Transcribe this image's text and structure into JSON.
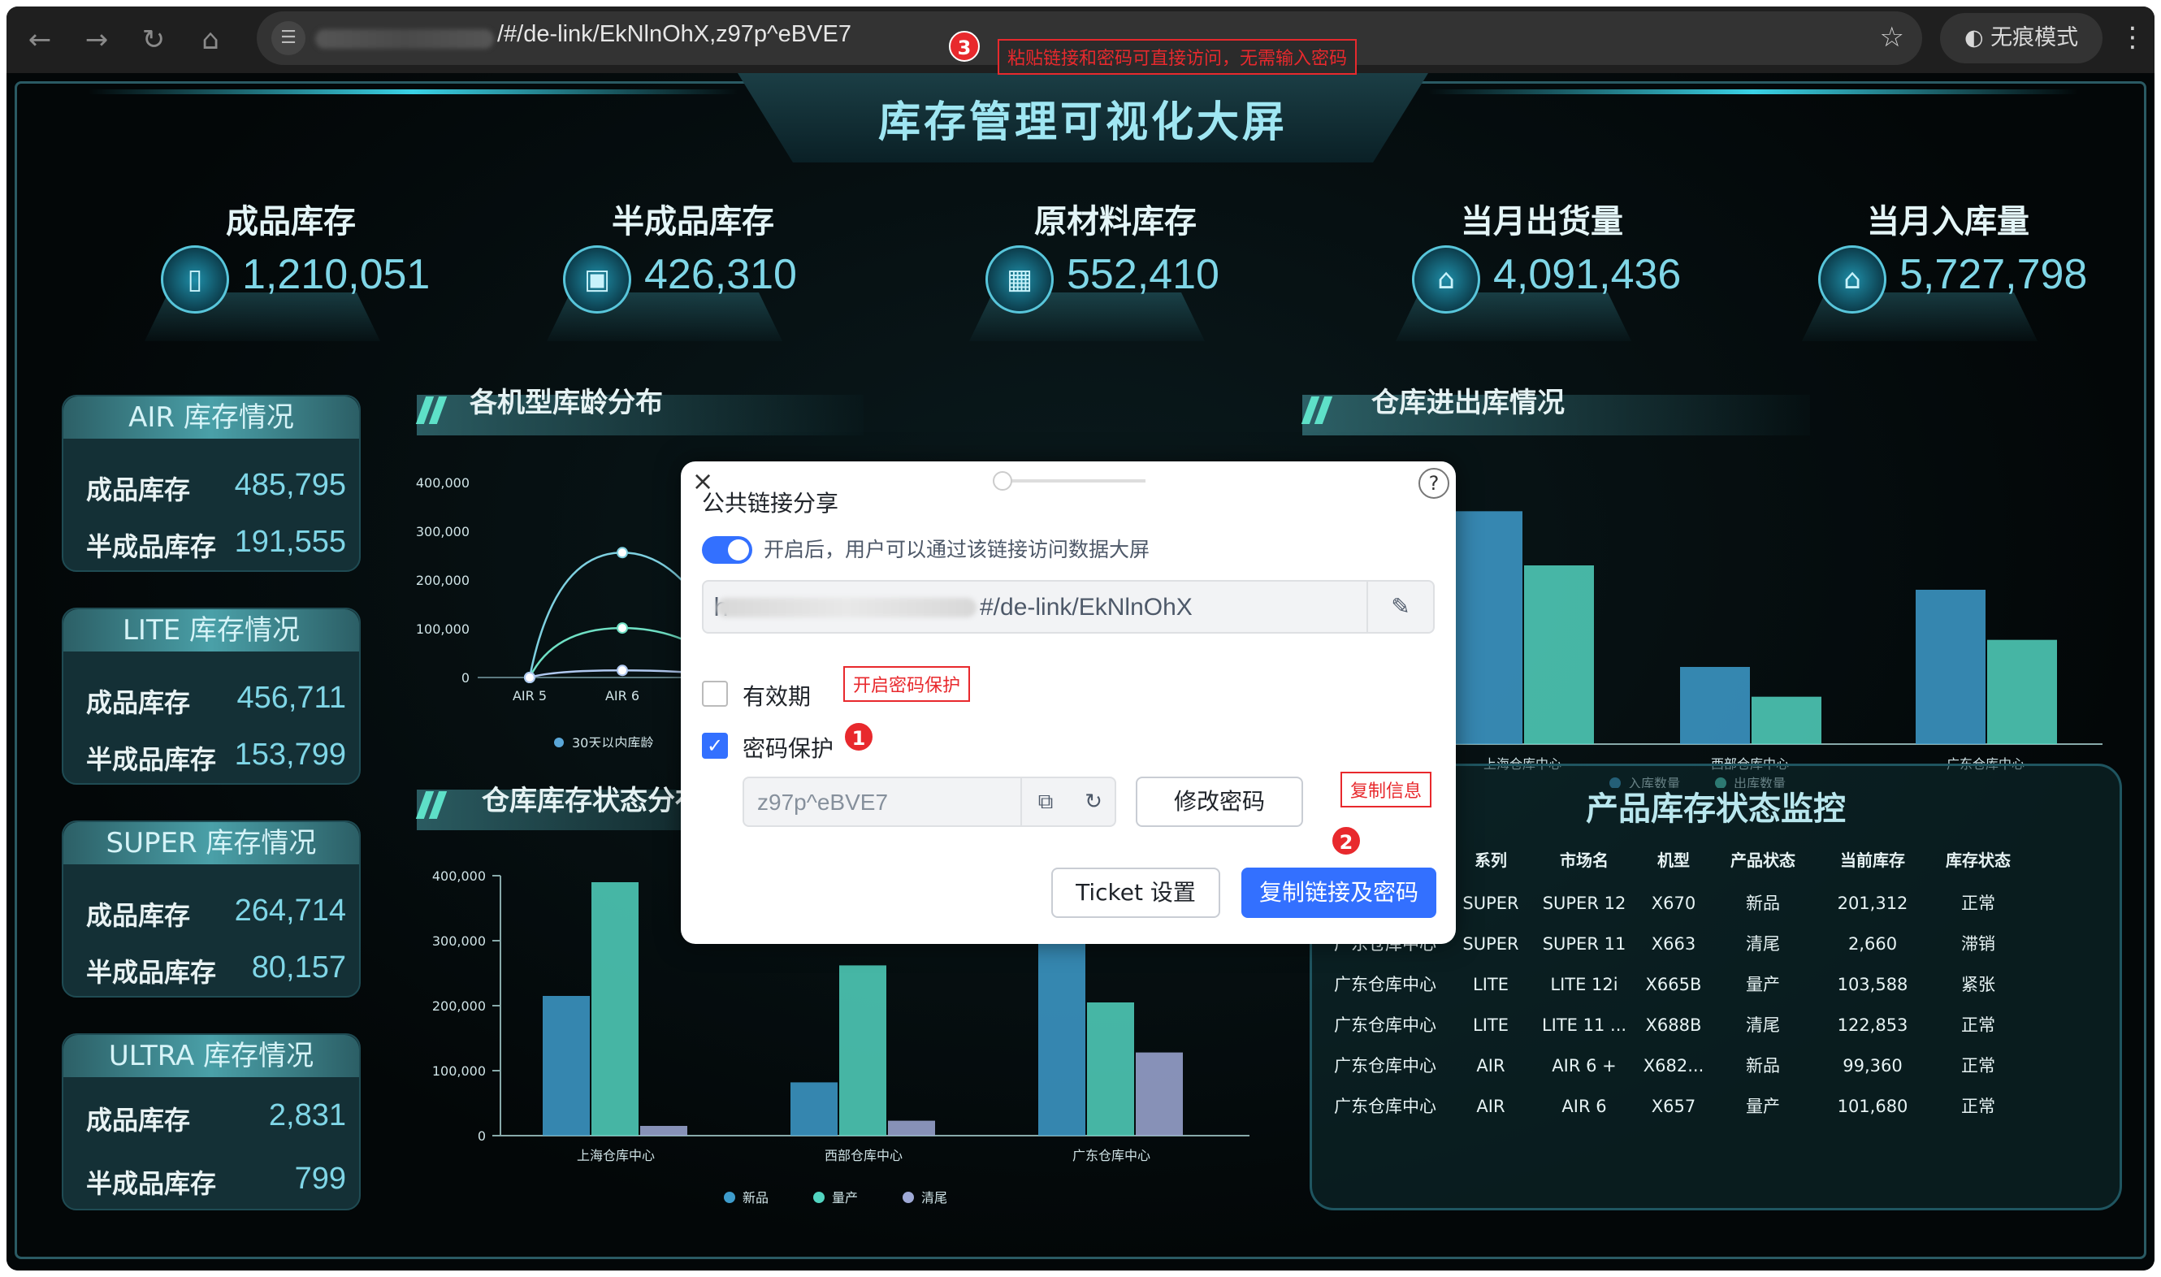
{
  "browser": {
    "url": "/#/de-link/EkNlnOhX,z97p^eBVE7",
    "incognito_label": "无痕模式"
  },
  "annotations": {
    "a1": "1",
    "a2": "2",
    "a3": "3",
    "note_pwd": "开启密码保护",
    "note_copy": "复制信息",
    "note_paste": "粘贴链接和密码可直接访问，无需输入密码"
  },
  "dashboard": {
    "title": "库存管理可视化大屏",
    "kpis": [
      {
        "label": "成品库存",
        "value": "1,210,051"
      },
      {
        "label": "半成品库存",
        "value": "426,310"
      },
      {
        "label": "原材料库存",
        "value": "552,410"
      },
      {
        "label": "当月出货量",
        "value": "4,091,436"
      },
      {
        "label": "当月入库量",
        "value": "5,727,798"
      }
    ],
    "side_cards": [
      {
        "title": "AIR 库存情况",
        "r1_label": "成品库存",
        "r1_value": "485,795",
        "r2_label": "半成品库存",
        "r2_value": "191,555"
      },
      {
        "title": "LITE 库存情况",
        "r1_label": "成品库存",
        "r1_value": "456,711",
        "r2_label": "半成品库存",
        "r2_value": "153,799"
      },
      {
        "title": "SUPER 库存情况",
        "r1_label": "成品库存",
        "r1_value": "264,714",
        "r2_label": "半成品库存",
        "r2_value": "80,157"
      },
      {
        "title": "ULTRA 库存情况",
        "r1_label": "成品库存",
        "r1_value": "2,831",
        "r2_label": "半成品库存",
        "r2_value": "799"
      }
    ],
    "sections": {
      "age_dist": "各机型库龄分布",
      "warehouse_io": "仓库进出库情况",
      "warehouse_status": "仓库库存状态分布",
      "product_monitor": "产品库存状态监控"
    },
    "table": {
      "headers": [
        "",
        "系列",
        "市场名",
        "机型",
        "产品状态",
        "当前库存",
        "库存状态"
      ],
      "rows": [
        [
          "",
          "SUPER",
          "SUPER 12",
          "X670",
          "新品",
          "201,312",
          "正常"
        ],
        [
          "广东仓库中心",
          "SUPER",
          "SUPER 11",
          "X663",
          "清尾",
          "2,660",
          "滞销"
        ],
        [
          "广东仓库中心",
          "LITE",
          "LITE 12i",
          "X665B",
          "量产",
          "103,588",
          "紧张"
        ],
        [
          "广东仓库中心",
          "LITE",
          "LITE 11 ...",
          "X688B",
          "清尾",
          "122,853",
          "正常"
        ],
        [
          "广东仓库中心",
          "AIR",
          "AIR 6 +",
          "X682...",
          "新品",
          "99,360",
          "正常"
        ],
        [
          "广东仓库中心",
          "AIR",
          "AIR 6",
          "X657",
          "量产",
          "101,680",
          "正常"
        ]
      ]
    }
  },
  "chart_data": [
    {
      "type": "line",
      "title": "各机型库龄分布",
      "categories": [
        "AIR 5",
        "AIR 6"
      ],
      "yticks": [
        "400,000",
        "300,000",
        "200,000",
        "100,000",
        "0"
      ],
      "ylim": [
        0,
        400000
      ],
      "legend": [
        "30天以内库龄"
      ],
      "series": [
        {
          "values": [
            0,
            265000
          ]
        },
        {
          "values": [
            0,
            105000
          ]
        },
        {
          "values": [
            0,
            15000
          ]
        }
      ]
    },
    {
      "type": "bar",
      "title": "仓库库存状态分布",
      "categories": [
        "上海仓库中心",
        "西部仓库中心",
        "广东仓库中心"
      ],
      "yticks": [
        "400,000",
        "300,000",
        "200,000",
        "100,000",
        "0"
      ],
      "ylim": [
        0,
        400000
      ],
      "legend": [
        "新品",
        "量产",
        "清尾"
      ],
      "series": [
        {
          "name": "新品",
          "values": [
            215000,
            82000,
            300000
          ],
          "color": "#3e9ccc"
        },
        {
          "name": "量产",
          "values": [
            390000,
            262000,
            205000
          ],
          "color": "#52d4c0"
        },
        {
          "name": "清尾",
          "values": [
            15000,
            23000,
            128000
          ],
          "color": "#9fa9d6"
        }
      ]
    },
    {
      "type": "bar",
      "title": "仓库进出库情况",
      "categories": [
        "上海仓库中心",
        "西部仓库中心",
        "广东仓库中心"
      ],
      "ylim": [
        0,
        900000
      ],
      "legend": [
        "入库数量",
        "出库数量"
      ],
      "series": [
        {
          "name": "入库数量",
          "values": [
            860000,
            285000,
            570000
          ],
          "color": "#3e9ccc"
        },
        {
          "name": "出库数量",
          "values": [
            660000,
            175000,
            385000
          ],
          "color": "#52d4c0"
        }
      ]
    }
  ],
  "modal": {
    "title": "公共链接分享",
    "toggle_desc": "开启后，用户可以通过该链接访问数据大屏",
    "link_prefix": "h",
    "link_value": "#/de-link/EkNlnOhX",
    "expiry_label": "有效期",
    "pwd_label": "密码保护",
    "pwd_value": "z97p^eBVE7",
    "change_pwd": "修改密码",
    "ticket_btn": "Ticket 设置",
    "copy_btn": "复制链接及密码",
    "help": "?",
    "close": "×"
  }
}
